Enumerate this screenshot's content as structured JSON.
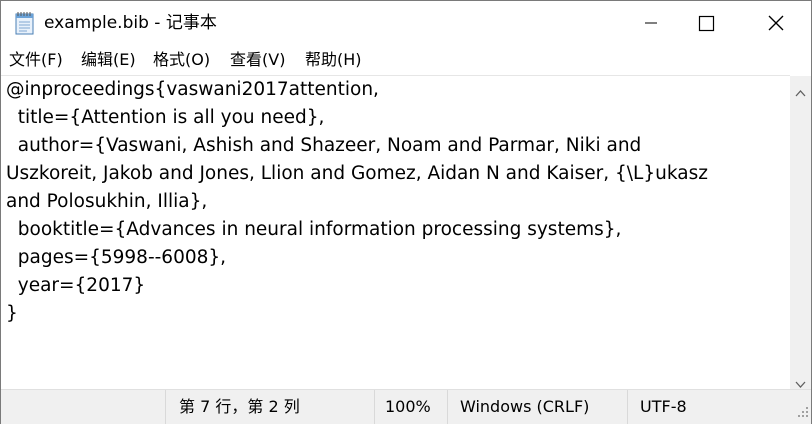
{
  "window": {
    "title": "example.bib - 记事本",
    "icon": "notepad-icon",
    "controls": [
      "minimize-icon",
      "maximize-icon",
      "close-icon"
    ]
  },
  "menu": {
    "items": [
      {
        "label": "文件(F)"
      },
      {
        "label": "编辑(E)"
      },
      {
        "label": "格式(O)"
      },
      {
        "label": "查看(V)"
      },
      {
        "label": "帮助(H)"
      }
    ]
  },
  "editor": {
    "content": "@inproceedings{vaswani2017attention,\n  title={Attention is all you need},\n  author={Vaswani, Ashish and Shazeer, Noam and Parmar, Niki and\nUszkoreit, Jakob and Jones, Llion and Gomez, Aidan N and Kaiser, {\\L}ukasz\nand Polosukhin, Illia},\n  booktitle={Advances in neural information processing systems},\n  pages={5998--6008},\n  year={2017}\n}"
  },
  "status": {
    "position": "第 7 行，第 2 列",
    "zoom": "100%",
    "line_ending": "Windows (CRLF)",
    "encoding": "UTF-8"
  },
  "colors": {
    "statusbar_bg": "#f0f0f0",
    "text": "#000000"
  }
}
